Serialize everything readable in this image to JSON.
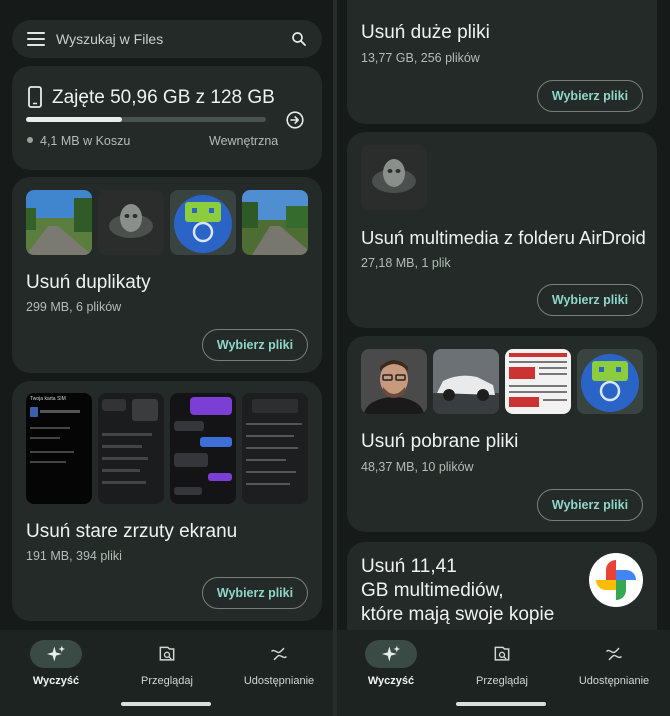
{
  "left": {
    "search": {
      "placeholder": "Wyszukaj w Files"
    },
    "storage": {
      "title": "Zajęte 50,96 GB z 128 GB",
      "used_fraction": 0.398,
      "trash": "4,1 MB w Koszu",
      "location": "Wewnętrzna"
    },
    "duplicates": {
      "title": "Usuń duplikaty",
      "sub": "299 MB, 6 plików",
      "button": "Wybierz pliki"
    },
    "screenshots": {
      "title": "Usuń stare zrzuty ekranu",
      "sub": "191 MB, 394 pliki",
      "button": "Wybierz pliki",
      "sim_title": "Twoja karta SIM"
    }
  },
  "right": {
    "large": {
      "title": "Usuń duże pliki",
      "sub": "13,77 GB, 256 plików",
      "button": "Wybierz pliki"
    },
    "airdroid": {
      "title": "Usuń multimedia z folderu AirDroid",
      "sub": "27,18 MB, 1 plik",
      "button": "Wybierz pliki"
    },
    "downloads": {
      "title": "Usuń pobrane pliki",
      "sub": "48,37 MB, 10 plików",
      "button": "Wybierz pliki"
    },
    "backup": {
      "line1": "Usuń 11,41",
      "line2": "GB multimediów,",
      "line3": "które mają swoje kopie"
    }
  },
  "nav": {
    "items": [
      {
        "label": "Wyczyść",
        "icon": "sparkle-icon",
        "active": true
      },
      {
        "label": "Przeglądaj",
        "icon": "browse-icon",
        "active": false
      },
      {
        "label": "Udostępnianie",
        "icon": "share-icon",
        "active": false
      }
    ]
  },
  "colors": {
    "accent": "#8fd6c7",
    "background": "#161a19",
    "card": "#232a28"
  }
}
